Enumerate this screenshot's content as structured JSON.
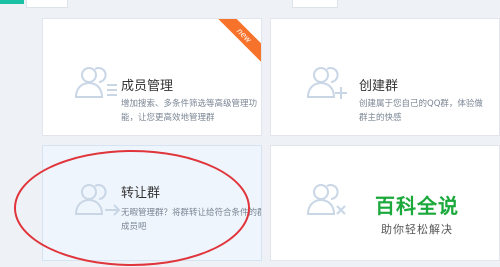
{
  "cards": [
    {
      "title": "成员管理",
      "desc": "增加搜索、多条件筛选等高级管理功能，让您更高效地管理群",
      "badge": "new"
    },
    {
      "title": "创建群",
      "desc": "创建属于您自己的QQ群，体验做群主的快感"
    },
    {
      "title": "转让群",
      "desc": "无暇管理群？将群转让给符合条件的群成员吧"
    },
    {
      "title": "",
      "desc": ""
    }
  ],
  "watermark": {
    "main": "百科全说",
    "sub": "助你轻松解决"
  },
  "colors": {
    "icon": "#c9d6e6",
    "badge": "#f7722a",
    "highlight": "#e0353b",
    "watermark": "#1aa93a"
  }
}
